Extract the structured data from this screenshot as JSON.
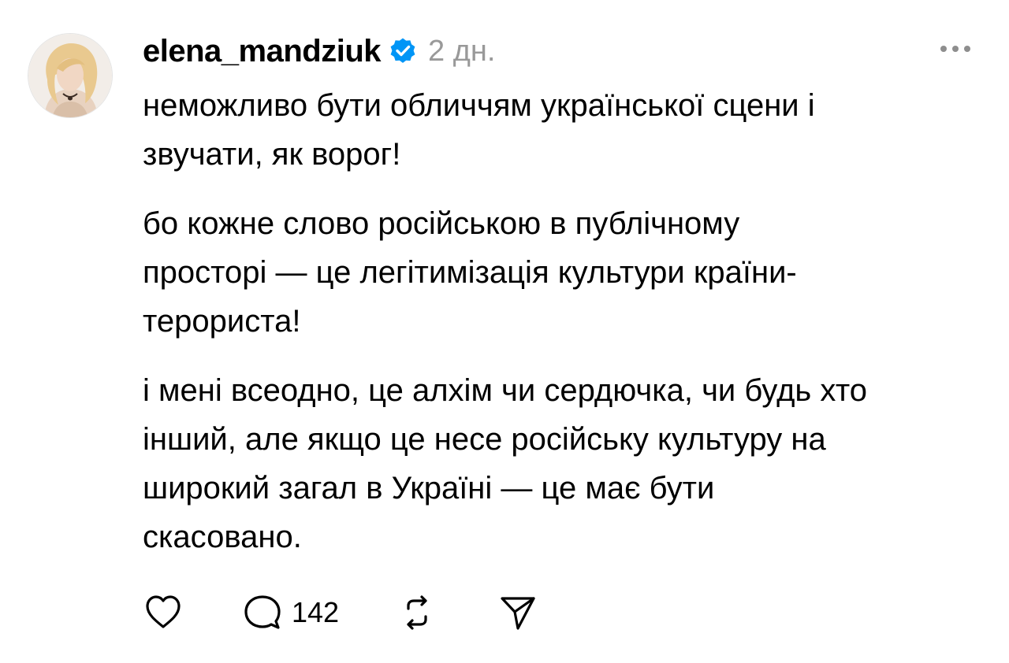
{
  "post": {
    "username": "elena_mandziuk",
    "time": "2 дн.",
    "paragraphs": [
      "неможливо бути обличчям української сцени і\nзвучати, як ворог!",
      "бо кожне слово російською в публічному\nпросторі — це легітимізація культури країни-\nтерориста!",
      "і мені всеодно, це алхім чи сердючка, чи будь хто\nінший, але якщо це несе російську культуру на\nширокий загал в Україні — це має бути\nскасовано."
    ],
    "actions": {
      "comment_count": "142"
    }
  },
  "icons": {
    "avatar": "profile-photo",
    "verified": "verified-badge-icon",
    "more": "more-horizontal-icon",
    "like": "heart-icon",
    "comment": "comment-bubble-icon",
    "repost": "repost-icon",
    "share": "send-icon"
  },
  "colors": {
    "verified_badge": "#0095f6",
    "timestamp": "#999999",
    "text": "#000000"
  }
}
